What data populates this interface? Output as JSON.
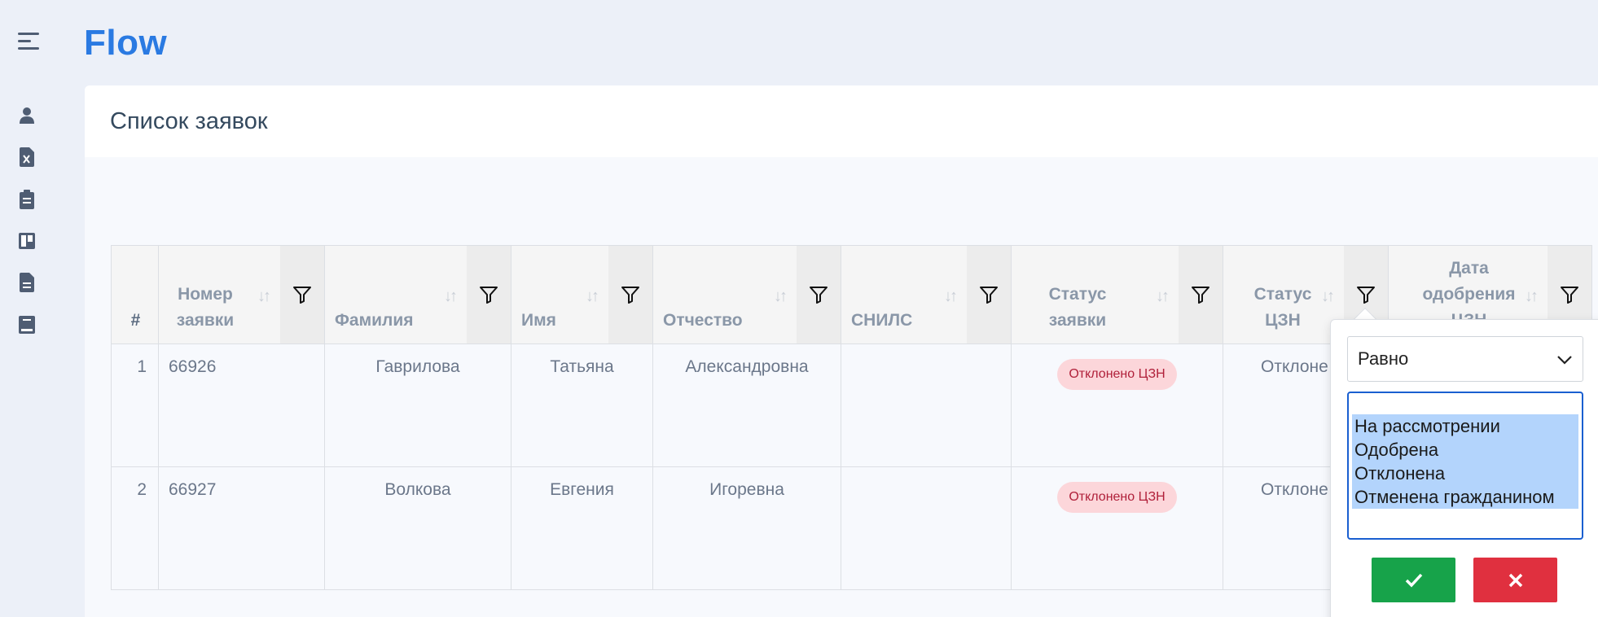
{
  "app": {
    "brand": "Flow"
  },
  "sidebar": {
    "icons": [
      "menu-icon",
      "user-icon",
      "excel-file-icon",
      "clipboard-icon",
      "board-icon",
      "document-icon",
      "book-icon"
    ]
  },
  "page": {
    "title": "Список заявок"
  },
  "table": {
    "columns": [
      {
        "label": "#"
      },
      {
        "label": "Номер заявки"
      },
      {
        "label": "Фамилия"
      },
      {
        "label": "Имя"
      },
      {
        "label": "Отчество"
      },
      {
        "label": "СНИЛС"
      },
      {
        "label": "Статус заявки"
      },
      {
        "label": "Статус ЦЗН"
      },
      {
        "label": "Дата одобрения ЦЗН"
      }
    ],
    "rows": [
      {
        "index": "1",
        "number": "66926",
        "last_name": "Гаврилова",
        "first_name": "Татьяна",
        "patronymic": "Александровна",
        "snils": "",
        "status": "Отклонено ЦЗН",
        "czn_status": "Отклоне"
      },
      {
        "index": "2",
        "number": "66927",
        "last_name": "Волкова",
        "first_name": "Евгения",
        "patronymic": "Игоревна",
        "snils": "",
        "status": "Отклонено ЦЗН",
        "czn_status": "Отклоне"
      }
    ]
  },
  "filter_popup": {
    "operator": "Равно",
    "options": [
      "На рассмотрении",
      "Одобрена",
      "Отклонена",
      "Отменена гражданином"
    ],
    "confirm_icon": "check-icon",
    "cancel_icon": "cross-icon"
  },
  "colors": {
    "brand": "#2a7ae2",
    "badge_bg": "#fcd6da",
    "badge_text": "#b0203a",
    "confirm": "#17a34a",
    "cancel": "#e0303f",
    "listbox_border": "#1a5fd0",
    "selection": "#b3d4fc"
  }
}
